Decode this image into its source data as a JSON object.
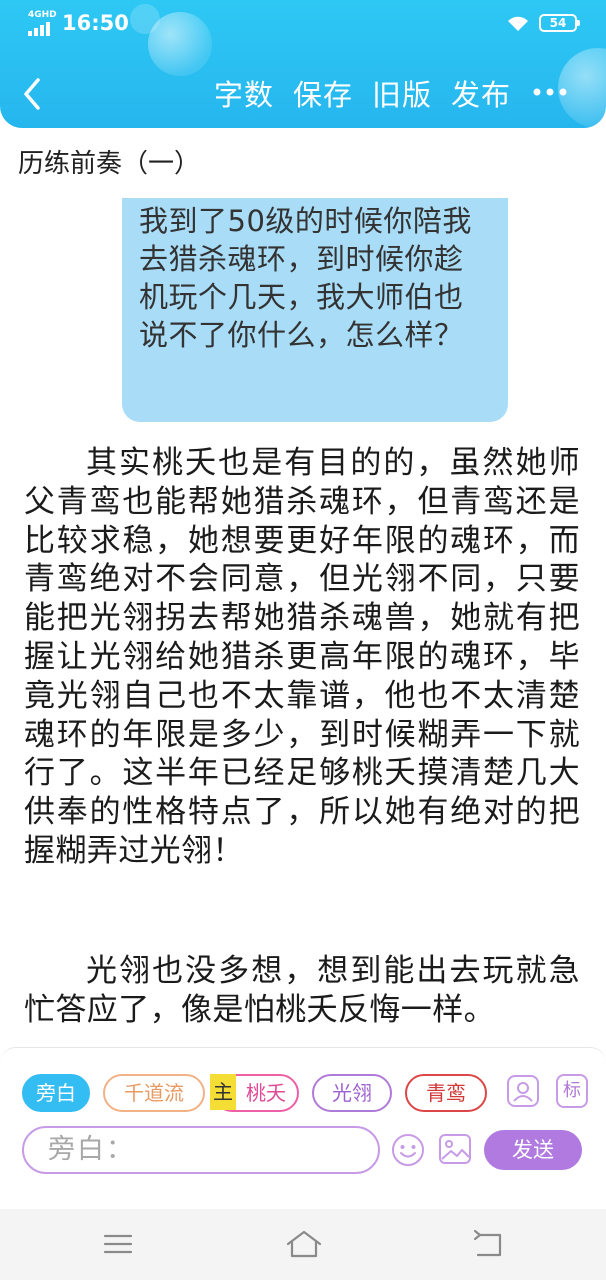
{
  "status_bar": {
    "network": "4GHD",
    "time": "16:50",
    "battery": "54",
    "icons": [
      "signal-icon",
      "wifi-icon",
      "battery-icon"
    ]
  },
  "header": {
    "back_icon": "chevron-left-icon",
    "toolbar": [
      "字数",
      "保存",
      "旧版",
      "发布"
    ],
    "more_icon": "more-dots-icon",
    "accent_color": "#2ec8f4"
  },
  "content": {
    "chapter_title": "历练前奏（一）",
    "dialog_text": "我到了50级的时候你陪我去猎杀魂环，到时候你趁机玩个几天，我大师伯也说不了你什么，怎么样？",
    "paragraphs": [
      "其实桃夭也是有目的的，虽然她师父青鸾也能帮她猎杀魂环，但青鸾还是比较求稳，她想要更好年限的魂环，而青鸾绝对不会同意，但光翎不同，只要能把光翎拐去帮她猎杀魂兽，她就有把握让光翎给她猎杀更高年限的魂环，毕竟光翎自己也不太靠谱，他也不太清楚魂环的年限是多少，到时候糊弄一下就行了。这半年已经足够桃夭摸清楚几大供奉的性格特点了，所以她有绝对的把握糊弄过光翎！",
      "光翎也没多想，想到能出去玩就急忙答应了，像是怕桃夭反悔一样。"
    ]
  },
  "input_panel": {
    "roles": [
      "旁白",
      "千道流",
      "桃夭",
      "光翎",
      "青鸾"
    ],
    "main_badge": "主",
    "tag_label": "标",
    "placeholder": "旁白：",
    "send_label": "发送",
    "icons": [
      "contact-card-icon",
      "emoji-icon",
      "image-icon"
    ],
    "colors": {
      "narrator": "#34bdf2",
      "qiandaoliu": "#e89a64",
      "taoyao": "#e24a97",
      "guangling": "#9e62d0",
      "qingluan": "#d23a3a",
      "send": "#b07ae0"
    }
  },
  "nav_bar": {
    "icons": [
      "menu-icon",
      "home-icon",
      "back-icon"
    ]
  }
}
